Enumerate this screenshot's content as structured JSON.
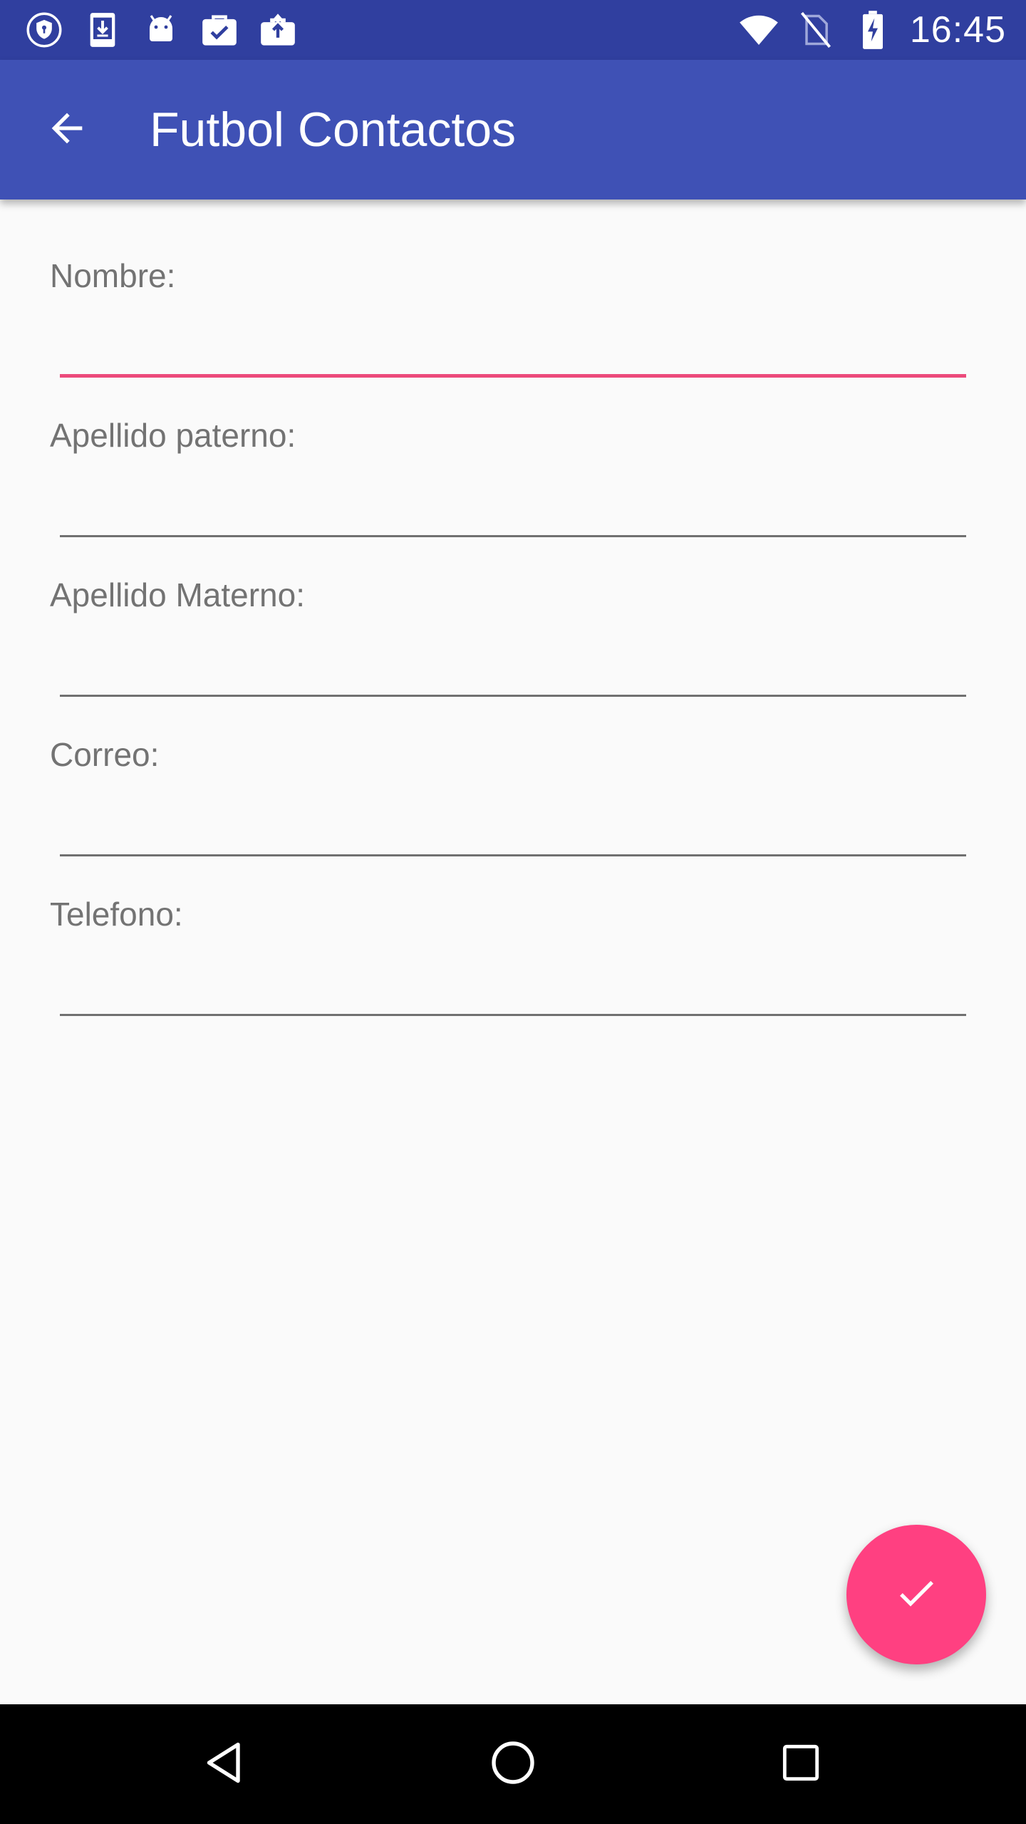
{
  "status_bar": {
    "time": "16:45",
    "left_icons": [
      "shield-icon",
      "download-icon",
      "android-icon",
      "briefcase-check-icon",
      "briefcase-upload-icon"
    ],
    "right_icons": [
      "wifi-icon",
      "no-sim-icon",
      "battery-charging-icon"
    ]
  },
  "app_bar": {
    "title": "Futbol Contactos",
    "back_icon": "arrow-back-icon"
  },
  "form": {
    "fields": [
      {
        "label": "Nombre:",
        "value": "",
        "placeholder": ""
      },
      {
        "label": "Apellido paterno:",
        "value": "",
        "placeholder": ""
      },
      {
        "label": "Apellido Materno:",
        "value": "",
        "placeholder": ""
      },
      {
        "label": "Correo:",
        "value": "",
        "placeholder": ""
      },
      {
        "label": "Telefono:",
        "value": "",
        "placeholder": ""
      }
    ]
  },
  "fab": {
    "icon": "check-icon"
  },
  "nav_bar": {
    "icons": [
      "back-triangle-icon",
      "home-circle-icon",
      "recents-square-icon"
    ]
  },
  "colors": {
    "status_bar": "#303f9f",
    "app_bar": "#3f51b5",
    "accent": "#ff4081",
    "focused_underline": "#ec4a7b",
    "background": "#fafafa"
  }
}
